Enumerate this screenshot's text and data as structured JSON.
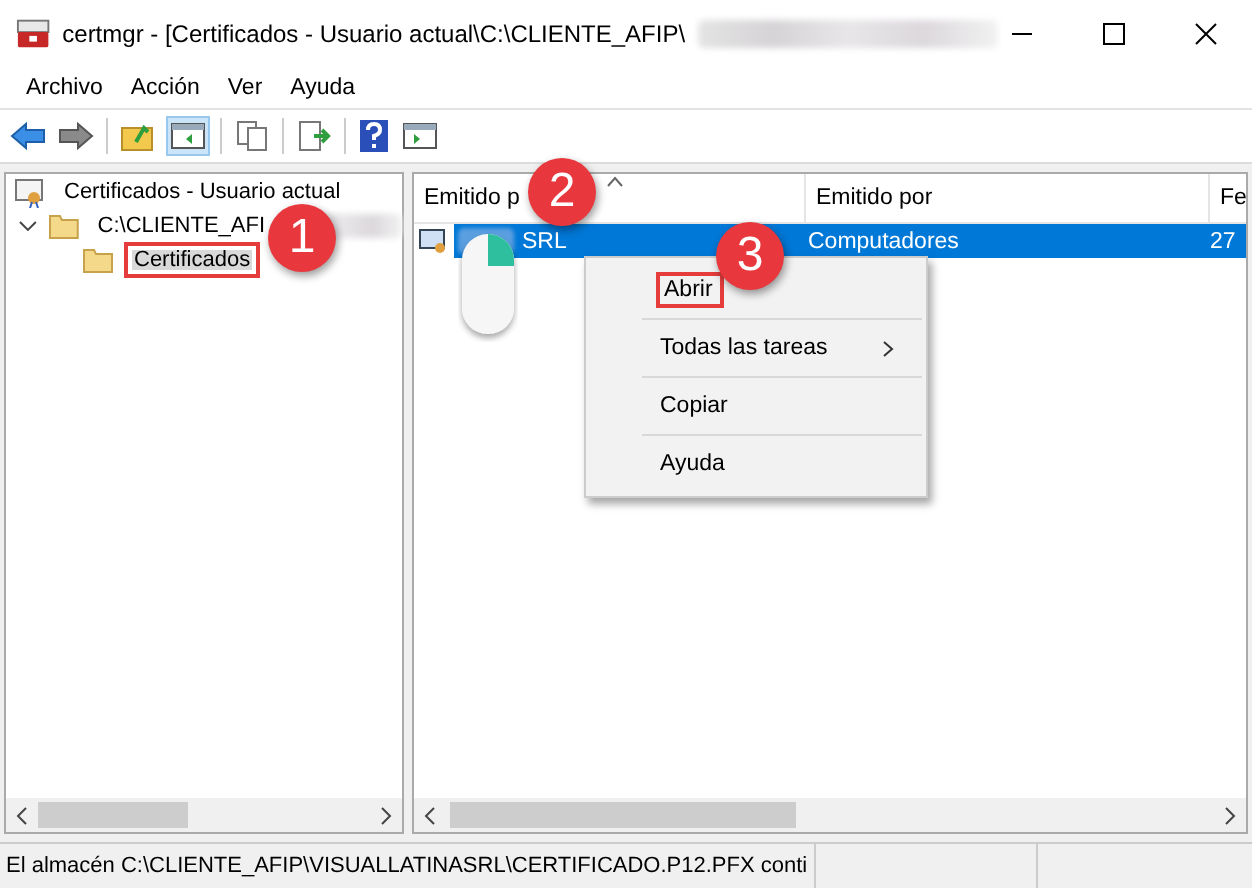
{
  "window": {
    "title": "certmgr - [Certificados - Usuario actual\\C:\\CLIENTE_AFIP\\"
  },
  "menu": [
    "Archivo",
    "Acción",
    "Ver",
    "Ayuda"
  ],
  "tree": [
    {
      "label": "Certificados - Usuario actual",
      "kind": "root",
      "selected": false,
      "highlighted": false,
      "children": [
        {
          "label": "C:\\CLIENTE_AFI",
          "kind": "folder",
          "expanded": true,
          "selected": false,
          "highlighted": false,
          "children": [
            {
              "label": "Certificados",
              "kind": "folder",
              "selected": true,
              "highlighted": true
            }
          ]
        }
      ]
    }
  ],
  "table": {
    "columns": [
      "Emitido p",
      "Emitido por",
      "Fe"
    ],
    "rows": [
      {
        "cells": [
          "SRL",
          "Computadores",
          "27"
        ],
        "selected": true
      }
    ]
  },
  "context_menu": {
    "items": [
      {
        "label": "Abrir",
        "kind": "item",
        "highlighted": true
      },
      {
        "label": "Todas las tareas",
        "kind": "submenu",
        "highlighted": false
      },
      {
        "label": "Copiar",
        "kind": "item",
        "highlighted": false
      },
      {
        "label": "Ayuda",
        "kind": "item",
        "highlighted": false
      }
    ]
  },
  "annotations": [
    {
      "label": "1"
    },
    {
      "label": "2"
    },
    {
      "label": "3"
    }
  ],
  "status_bar": "El almacén C:\\CLIENTE_AFIP\\VISUALLATINASRL\\CERTIFICADO.P12.PFX conti"
}
